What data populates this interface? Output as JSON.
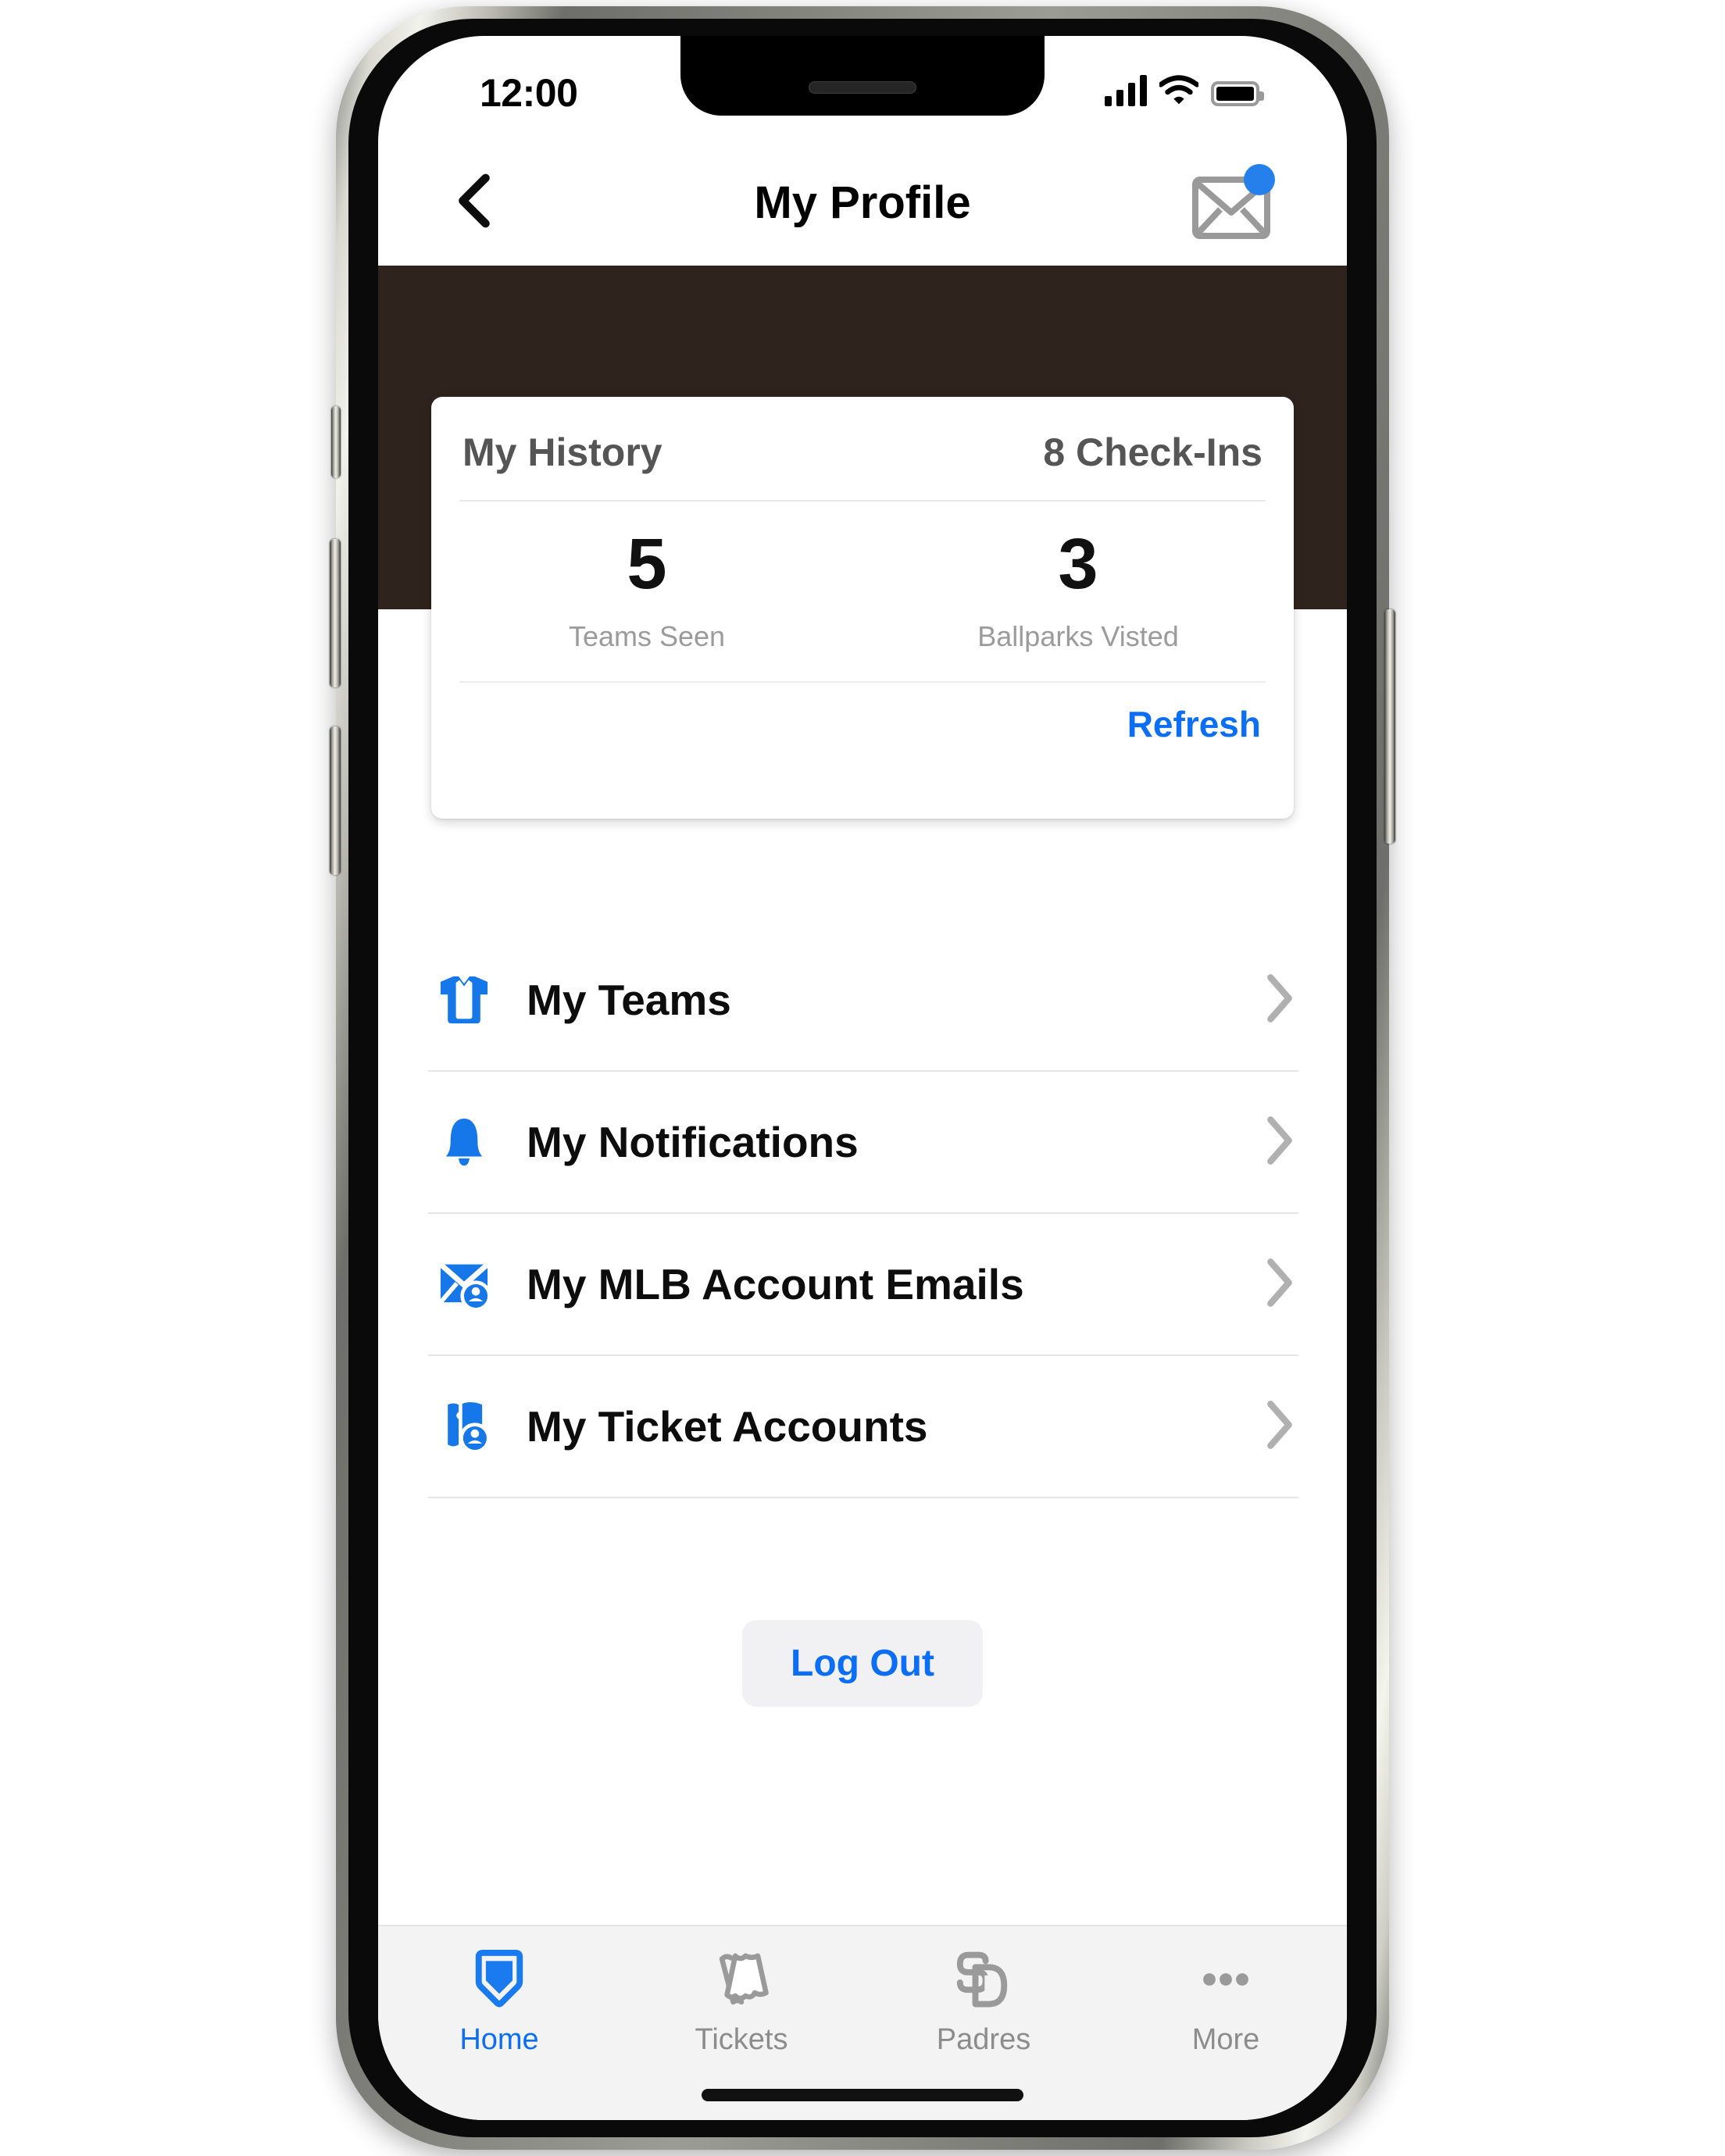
{
  "status_bar": {
    "time": "12:00",
    "signal_icon": "cellular-signal-icon",
    "wifi_icon": "wifi-icon",
    "battery_icon": "battery-full-icon"
  },
  "nav": {
    "back_icon": "back-chevron-icon",
    "title": "My Profile",
    "mail_icon": "mail-envelope-icon",
    "mail_badge": "unread-badge"
  },
  "theme": {
    "banner_color": "#2f241d",
    "accent_blue": "#0b6ef5",
    "icon_blue": "#1677e8",
    "muted_gray": "#8c8c8c"
  },
  "history_card": {
    "title": "My History",
    "checkins": "8 Check-Ins",
    "stats": [
      {
        "value": "5",
        "label": "Teams Seen"
      },
      {
        "value": "3",
        "label": "Ballparks Visted"
      }
    ],
    "refresh_label": "Refresh"
  },
  "menu": {
    "items": [
      {
        "label": "My Teams",
        "icon": "jersey-icon",
        "chevron": "chevron-right-icon"
      },
      {
        "label": "My Notifications",
        "icon": "bell-icon",
        "chevron": "chevron-right-icon"
      },
      {
        "label": "My MLB Account Emails",
        "icon": "mail-account-icon",
        "chevron": "chevron-right-icon"
      },
      {
        "label": "My Ticket Accounts",
        "icon": "ticket-account-icon",
        "chevron": "chevron-right-icon"
      }
    ]
  },
  "logout": {
    "label": "Log Out"
  },
  "tabbar": {
    "tabs": [
      {
        "label": "Home",
        "icon": "home-plate-icon",
        "active": true
      },
      {
        "label": "Tickets",
        "icon": "tickets-icon",
        "active": false
      },
      {
        "label": "Padres",
        "icon": "padres-sd-logo-icon",
        "active": false
      },
      {
        "label": "More",
        "icon": "ellipsis-icon",
        "active": false
      }
    ]
  }
}
